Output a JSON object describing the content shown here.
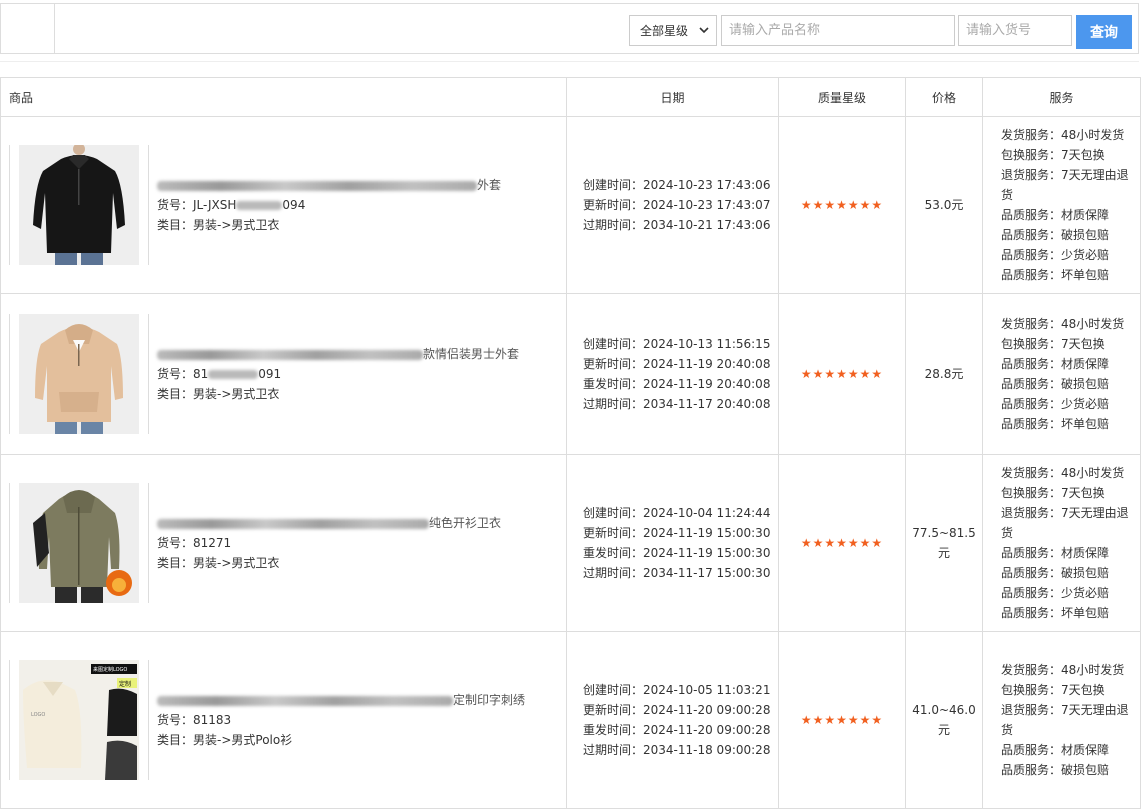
{
  "toolbar": {
    "grade_select": "全部星级",
    "name_placeholder": "请输入产品名称",
    "sku_placeholder": "请输入货号",
    "query_label": "查询"
  },
  "table": {
    "headers": {
      "product": "商品",
      "date": "日期",
      "grade": "质量星级",
      "price": "价格",
      "service": "服务"
    },
    "rows": [
      {
        "title_visible": "外套",
        "sku": "货号：JL-JXSH",
        "sku_tail": "094",
        "category": "类目：男装->男式卫衣",
        "dates": [
          "创建时间：2024-10-23 17:43:06",
          "更新时间：2024-10-23 17:43:07",
          "过期时间：2034-10-21 17:43:06"
        ],
        "stars": "★★★★★★★",
        "price": "53.0元",
        "services": [
          "发货服务：48小时发货",
          "包换服务：7天包换",
          "退货服务：7天无理由退货",
          "品质服务：材质保障",
          "品质服务：破损包赔",
          "品质服务：少货必赔",
          "品质服务：坏单包赔"
        ],
        "image": "black-hoodie"
      },
      {
        "title_visible": "款情侣装男士外套",
        "sku": "货号：81",
        "sku_tail": "091",
        "category": "类目：男装->男式卫衣",
        "dates": [
          "创建时间：2024-10-13 11:56:15",
          "更新时间：2024-11-19 20:40:08",
          "重发时间：2024-11-19 20:40:08",
          "过期时间：2034-11-17 20:40:08"
        ],
        "stars": "★★★★★★★",
        "price": "28.8元",
        "services": [
          "发货服务：48小时发货",
          "包换服务：7天包换",
          "品质服务：材质保障",
          "品质服务：破损包赔",
          "品质服务：少货必赔",
          "品质服务：坏单包赔"
        ],
        "image": "beige-hoodie"
      },
      {
        "title_visible": "纯色开衫卫衣",
        "sku": "货号：81271",
        "sku_tail": "",
        "category": "类目：男装->男式卫衣",
        "dates": [
          "创建时间：2024-10-04 11:24:44",
          "更新时间：2024-11-19 15:00:30",
          "重发时间：2024-11-19 15:00:30",
          "过期时间：2034-11-17 15:00:30"
        ],
        "stars": "★★★★★★★",
        "price": "77.5~81.5元",
        "services": [
          "发货服务：48小时发货",
          "包换服务：7天包换",
          "退货服务：7天无理由退货",
          "品质服务：材质保障",
          "品质服务：破损包赔",
          "品质服务：少货必赔",
          "品质服务：坏单包赔"
        ],
        "image": "olive-jacket"
      },
      {
        "title_visible": "定制印字刺绣",
        "sku": "货号：81183",
        "sku_tail": "",
        "category": "类目：男装->男式Polo衫",
        "dates": [
          "创建时间：2024-10-05 11:03:21",
          "更新时间：2024-11-20 09:00:28",
          "重发时间：2024-11-20 09:00:28",
          "过期时间：2034-11-18 09:00:28"
        ],
        "stars": "★★★★★★★",
        "price": "41.0~46.0元",
        "services": [
          "发货服务：48小时发货",
          "包换服务：7天包换",
          "退货服务：7天无理由退货",
          "品质服务：材质保障",
          "品质服务：破损包赔"
        ],
        "image": "polo-sweatshirt",
        "image_text": [
          "来图定制LOGO",
          "定制",
          "LOGO"
        ]
      }
    ]
  }
}
